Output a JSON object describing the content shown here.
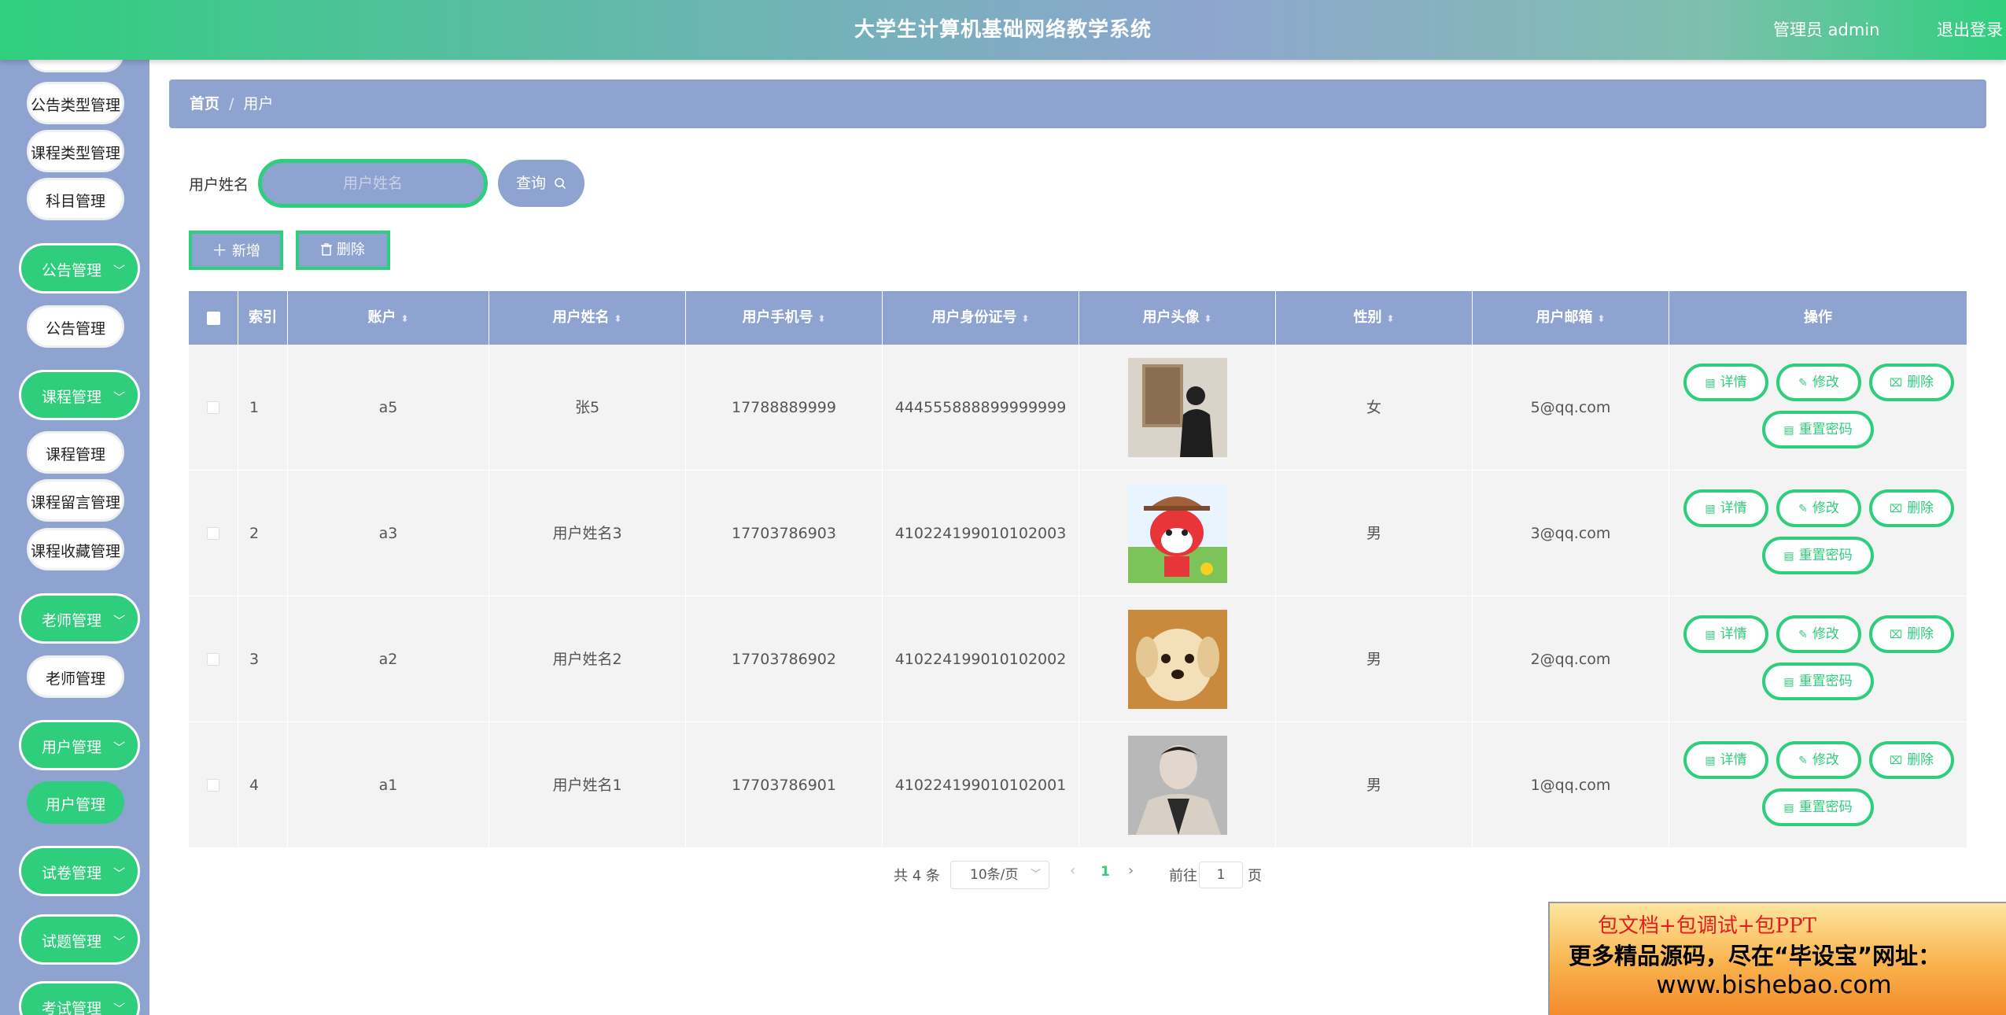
{
  "header": {
    "title": "大学生计算机基础网络教学系统",
    "admin": "管理员 admin",
    "logout": "退出登录"
  },
  "sidebar": {
    "items": [
      {
        "label": "公告类型管理"
      },
      {
        "label": "课程类型管理"
      },
      {
        "label": "科目管理"
      },
      {
        "label": "公告管理"
      },
      {
        "label": "课程管理"
      },
      {
        "label": "课程留言管理"
      },
      {
        "label": "课程收藏管理"
      },
      {
        "label": "老师管理"
      },
      {
        "label": "用户管理"
      }
    ],
    "groups": [
      {
        "label": "公告管理"
      },
      {
        "label": "课程管理"
      },
      {
        "label": "老师管理"
      },
      {
        "label": "用户管理"
      },
      {
        "label": "试卷管理"
      },
      {
        "label": "试题管理"
      },
      {
        "label": "考试管理"
      }
    ]
  },
  "breadcrumb": {
    "home": "首页",
    "sep": "/",
    "current": "用户"
  },
  "search": {
    "label": "用户姓名",
    "placeholder": "用户姓名",
    "button": "查询"
  },
  "actions": {
    "add": "新增",
    "delete": "删除"
  },
  "table": {
    "headers": [
      "索引",
      "账户",
      "用户姓名",
      "用户手机号",
      "用户身份证号",
      "用户头像",
      "性别",
      "用户邮箱",
      "操作"
    ],
    "rows": [
      {
        "index": "1",
        "account": "a5",
        "name": "张5",
        "phone": "17788889999",
        "idcard": "444555888899999999",
        "avatar": "man-in-gallery",
        "gender": "女",
        "email": "5@qq.com"
      },
      {
        "index": "2",
        "account": "a3",
        "name": "用户姓名3",
        "phone": "17703786903",
        "idcard": "410224199010102003",
        "avatar": "cartoon-fox",
        "gender": "男",
        "email": "3@qq.com"
      },
      {
        "index": "3",
        "account": "a2",
        "name": "用户姓名2",
        "phone": "17703786902",
        "idcard": "410224199010102002",
        "avatar": "puppy",
        "gender": "男",
        "email": "2@qq.com"
      },
      {
        "index": "4",
        "account": "a1",
        "name": "用户姓名1",
        "phone": "17703786901",
        "idcard": "410224199010102001",
        "avatar": "man-portrait",
        "gender": "男",
        "email": "1@qq.com"
      }
    ],
    "ops": {
      "detail": "详情",
      "edit": "修改",
      "delete": "删除",
      "reset": "重置密码"
    }
  },
  "pagination": {
    "total": "共 4 条",
    "size": "10条/页",
    "current": "1",
    "goto": "前往",
    "goto_value": "1",
    "page": "页"
  },
  "ad": {
    "line1": "包文档+包调试+包PPT",
    "line2": "更多精品源码，尽在“毕设宝”网址：",
    "line3": "www.bishebao.com"
  },
  "colors": {
    "accent": "#2fce7c",
    "panel": "#8fa3d0"
  }
}
